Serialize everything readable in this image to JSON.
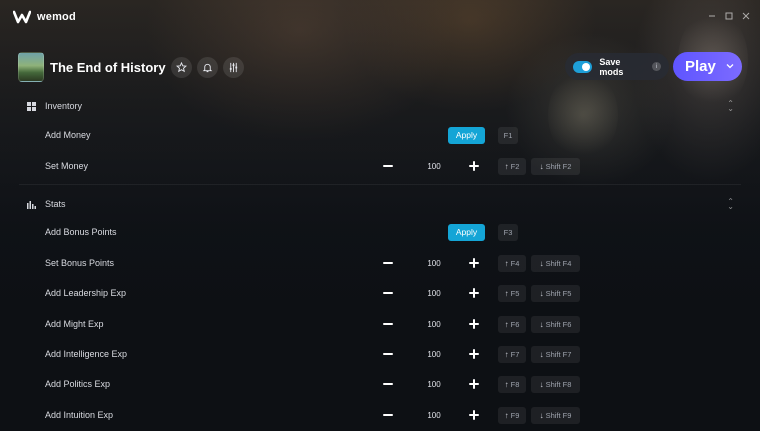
{
  "app": {
    "name": "wemod"
  },
  "game": {
    "title": "The End of History"
  },
  "header": {
    "save_mods_label": "Save mods",
    "info_label": "i",
    "play_label": "Play"
  },
  "sections": [
    {
      "title": "Inventory",
      "icon": "grid-icon",
      "mods": [
        {
          "name": "Add Money",
          "type": "apply",
          "button": "Apply",
          "key": "F1"
        },
        {
          "name": "Set Money",
          "type": "stepper",
          "value": "100",
          "key_up": "F2",
          "key_down": "Shift F2"
        }
      ]
    },
    {
      "title": "Stats",
      "icon": "bar-chart-icon",
      "mods": [
        {
          "name": "Add Bonus Points",
          "type": "apply",
          "button": "Apply",
          "key": "F3"
        },
        {
          "name": "Set Bonus Points",
          "type": "stepper",
          "value": "100",
          "key_up": "F4",
          "key_down": "Shift F4"
        },
        {
          "name": "Add Leadership Exp",
          "type": "stepper",
          "value": "100",
          "key_up": "F5",
          "key_down": "Shift F5"
        },
        {
          "name": "Add Might Exp",
          "type": "stepper",
          "value": "100",
          "key_up": "F6",
          "key_down": "Shift F6"
        },
        {
          "name": "Add Intelligence Exp",
          "type": "stepper",
          "value": "100",
          "key_up": "F7",
          "key_down": "Shift F7"
        },
        {
          "name": "Add Politics Exp",
          "type": "stepper",
          "value": "100",
          "key_up": "F8",
          "key_down": "Shift F8"
        },
        {
          "name": "Add Intuition Exp",
          "type": "stepper",
          "value": "100",
          "key_up": "F9",
          "key_down": "Shift F9"
        }
      ]
    }
  ],
  "colors": {
    "accent": "#14a5d6",
    "play": "#6b5dff",
    "background": "#0d1014"
  }
}
